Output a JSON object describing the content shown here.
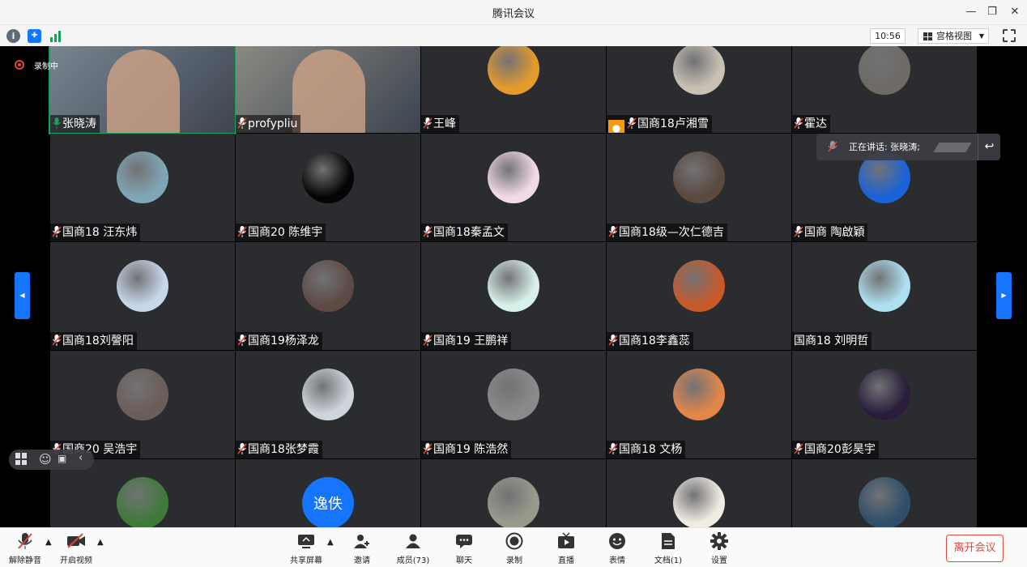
{
  "window": {
    "title": "腾讯会议"
  },
  "toolbar": {
    "time": "10:56",
    "view_mode": "宫格视图"
  },
  "recording": {
    "label": "录制中"
  },
  "speaking": {
    "text": "正在讲话: 张晓涛;"
  },
  "participants": [
    {
      "name": "张晓涛",
      "mic": "on",
      "kind": "video",
      "color": "#7b8a96"
    },
    {
      "name": "profypliu",
      "mic": "muted",
      "kind": "video",
      "color": "#8f8f86"
    },
    {
      "name": "王峰",
      "mic": "muted",
      "kind": "avatar",
      "color": "#e59a2c"
    },
    {
      "name": "国商18卢湘雪",
      "mic": "muted",
      "kind": "avatar",
      "color": "#c9c1b4",
      "badge": true
    },
    {
      "name": "霍达",
      "mic": "muted",
      "kind": "avatar",
      "color": "#6e6a64"
    },
    {
      "name": "国商18 汪东炜",
      "mic": "muted",
      "kind": "avatar",
      "color": "#7fa6b5"
    },
    {
      "name": "国商20 陈维宇",
      "mic": "muted",
      "kind": "avatar",
      "color": "#050505"
    },
    {
      "name": "国商18秦孟文",
      "mic": "muted",
      "kind": "avatar",
      "color": "#f2d9e8"
    },
    {
      "name": "国商18级—次仁德吉",
      "mic": "muted",
      "kind": "avatar",
      "color": "#5a4a40"
    },
    {
      "name": "国商 陶啟穎",
      "mic": "muted",
      "kind": "avatar",
      "color": "#1b62d6"
    },
    {
      "name": "国商18刘謦阳",
      "mic": "muted",
      "kind": "avatar",
      "color": "#c7d6ea"
    },
    {
      "name": "国商19杨泽龙",
      "mic": "muted",
      "kind": "avatar",
      "color": "#5e4a44"
    },
    {
      "name": "国商19 王鹏祥",
      "mic": "muted",
      "kind": "avatar",
      "color": "#d8f0ea"
    },
    {
      "name": "国商18李鑫蕊",
      "mic": "muted",
      "kind": "avatar",
      "color": "#c85a2a"
    },
    {
      "name": "国商18 刘明哲",
      "mic": "none",
      "kind": "avatar",
      "color": "#aee0f0"
    },
    {
      "name": "国商20 吴浩宇",
      "mic": "muted",
      "kind": "avatar",
      "color": "#6b5d58"
    },
    {
      "name": "国商18张梦霞",
      "mic": "muted",
      "kind": "avatar",
      "color": "#cfd5dc"
    },
    {
      "name": "国商19 陈浩然",
      "mic": "muted",
      "kind": "avatar",
      "color": "#8a8a8a"
    },
    {
      "name": "国商18 文杨",
      "mic": "muted",
      "kind": "avatar",
      "color": "#e2864a"
    },
    {
      "name": "国商20彭昊宇",
      "mic": "muted",
      "kind": "avatar",
      "color": "#2a1d3c"
    },
    {
      "name": "",
      "mic": "none",
      "kind": "avatar",
      "color": "#3f7a3a"
    },
    {
      "name": "",
      "mic": "none",
      "kind": "text",
      "avatar_text": "逸佚",
      "color": "#1675ff"
    },
    {
      "name": "",
      "mic": "none",
      "kind": "avatar",
      "color": "#9a9a8c"
    },
    {
      "name": "",
      "mic": "none",
      "kind": "avatar",
      "color": "#f0ebe3"
    },
    {
      "name": "",
      "mic": "none",
      "kind": "avatar",
      "color": "#2f4f6a"
    }
  ],
  "bottombar": {
    "unmute": "解除静音",
    "start_video": "开启视频",
    "share_screen": "共享屏幕",
    "invite": "邀请",
    "members": "成员(73)",
    "chat": "聊天",
    "record": "录制",
    "live": "直播",
    "reactions": "表情",
    "docs": "文档(1)",
    "settings": "设置",
    "leave": "离开会议"
  },
  "colors": {
    "accent": "#1675ff",
    "danger": "#e2453c",
    "tile": "#2b2c30"
  }
}
